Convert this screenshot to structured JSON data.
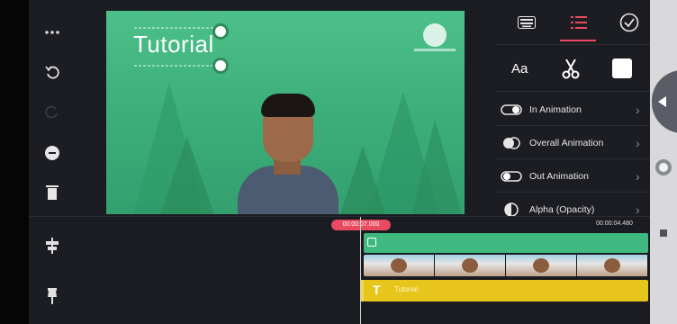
{
  "preview": {
    "title": "Tutorial"
  },
  "panel": {
    "font_label": "Aa",
    "animations": [
      {
        "label": "In Animation",
        "icon": "toggle-in-icon"
      },
      {
        "label": "Overall Animation",
        "icon": "overall-animation-icon"
      },
      {
        "label": "Out Animation",
        "icon": "toggle-out-icon"
      },
      {
        "label": "Alpha (Opacity)",
        "icon": "alpha-icon"
      }
    ]
  },
  "timeline": {
    "current_time": "00:00:07.000",
    "duration": "00:00:04.480",
    "text_layer_label": "Tutorial"
  },
  "colors": {
    "accent": "#e84a5f",
    "video_bg": "#3fb97f",
    "text_layer": "#e7c51c"
  }
}
